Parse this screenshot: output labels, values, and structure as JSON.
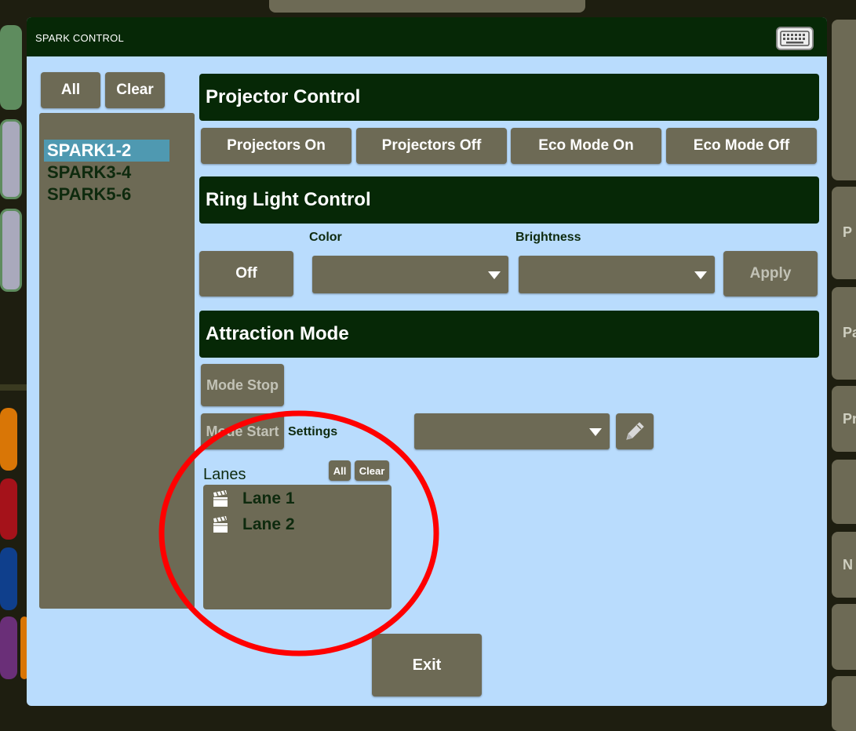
{
  "window": {
    "title": "SPARK CONTROL"
  },
  "groups": {
    "all_label": "All",
    "clear_label": "Clear",
    "items": [
      {
        "label": "SPARK1-2",
        "selected": true
      },
      {
        "label": "SPARK3-4",
        "selected": false
      },
      {
        "label": "SPARK5-6",
        "selected": false
      }
    ]
  },
  "projector": {
    "heading": "Projector Control",
    "buttons": [
      "Projectors On",
      "Projectors Off",
      "Eco Mode On",
      "Eco Mode Off"
    ]
  },
  "ring_light": {
    "heading": "Ring Light Control",
    "off_label": "Off",
    "color_label": "Color",
    "color_value": "",
    "brightness_label": "Brightness",
    "brightness_value": "",
    "apply_label": "Apply"
  },
  "attraction": {
    "heading": "Attraction Mode",
    "mode_stop_label": "Mode Stop",
    "mode_start_label": "Mode Start",
    "settings_label": "Settings",
    "settings_value": ""
  },
  "lanes": {
    "heading": "Lanes",
    "all_label": "All",
    "clear_label": "Clear",
    "items": [
      "Lane 1",
      "Lane 2"
    ]
  },
  "exit_label": "Exit",
  "background_app": {
    "right_letters": [
      "P",
      "Pa",
      "Pr",
      "N"
    ]
  },
  "colors": {
    "accent_dark": "#062806",
    "button": "#6d6a55",
    "panel": "#b9dcfd",
    "selection": "#4f99b1",
    "annotation": "#ff0000"
  },
  "icons": [
    "keyboard-icon",
    "pencil-icon",
    "clapperboard-icon",
    "chevron-down-icon"
  ]
}
